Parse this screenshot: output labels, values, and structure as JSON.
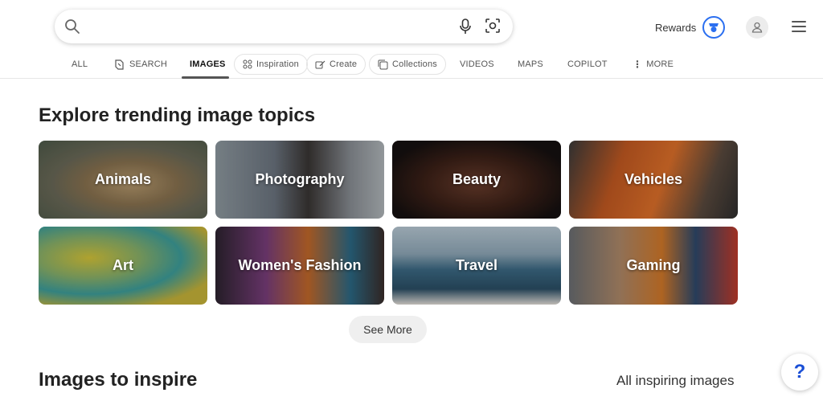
{
  "search": {
    "value": "",
    "placeholder": ""
  },
  "header": {
    "rewards_label": "Rewards"
  },
  "tabs": [
    {
      "label": "ALL"
    },
    {
      "label": "SEARCH"
    },
    {
      "label": "IMAGES"
    },
    {
      "label": "Inspiration"
    },
    {
      "label": "Create"
    },
    {
      "label": "Collections"
    },
    {
      "label": "VIDEOS"
    },
    {
      "label": "MAPS"
    },
    {
      "label": "COPILOT"
    },
    {
      "label": "MORE"
    }
  ],
  "trending": {
    "title": "Explore trending image topics",
    "tiles": [
      {
        "label": "Animals"
      },
      {
        "label": "Photography"
      },
      {
        "label": "Beauty"
      },
      {
        "label": "Vehicles"
      },
      {
        "label": "Art"
      },
      {
        "label": "Women's Fashion"
      },
      {
        "label": "Travel"
      },
      {
        "label": "Gaming"
      }
    ],
    "see_more": "See More"
  },
  "inspire": {
    "title": "Images to inspire",
    "link": "All inspiring images"
  },
  "help": {
    "label": "?"
  },
  "colors": {
    "accent": "#2b6ff0",
    "help": "#1a4fd6"
  },
  "icons": [
    "search-icon",
    "microphone-icon",
    "visual-search-icon",
    "rewards-icon",
    "user-icon",
    "menu-icon",
    "copilot-icon",
    "inspiration-icon",
    "create-icon",
    "collections-icon",
    "more-icon"
  ]
}
